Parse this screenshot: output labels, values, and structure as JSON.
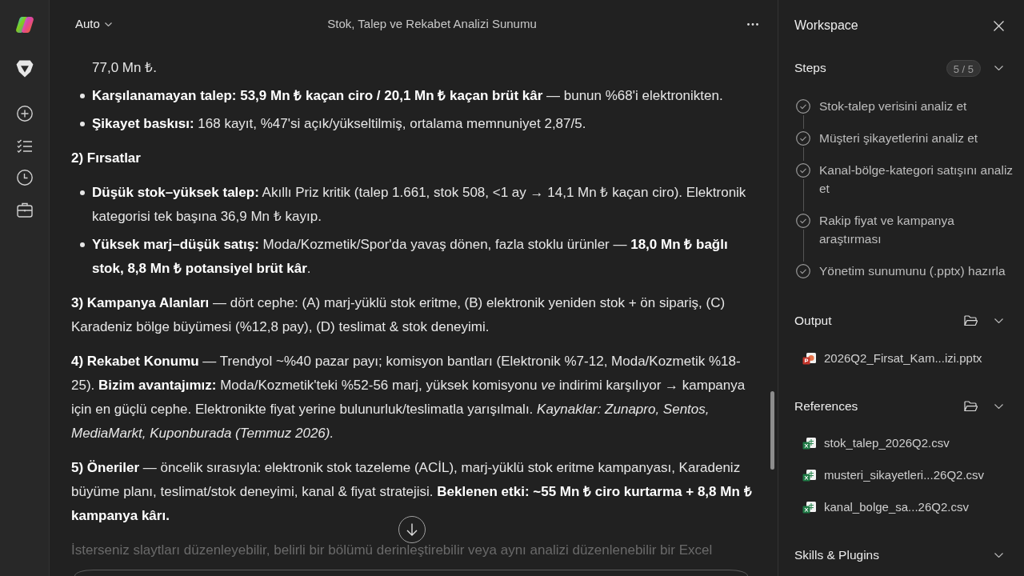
{
  "header": {
    "mode": "Auto",
    "title": "Stok, Talep ve Rekabet Analizi Sunumu"
  },
  "message": {
    "blocks": [
      {
        "kind": "continuation",
        "text": "77,0 Mn ₺."
      },
      {
        "kind": "bullet",
        "text": "**Karşılanamayan talep: 53,9 Mn ₺ kaçan ciro / 20,1 Mn ₺ kaçan brüt kâr** — bunun %68'i elektronikten."
      },
      {
        "kind": "bullet",
        "text": "**Şikayet baskısı:** 168 kayıt, %47'si açık/yükseltilmiş, ortalama memnuniyet 2,87/5."
      },
      {
        "kind": "heading",
        "text": "2) Fırsatlar"
      },
      {
        "kind": "bullet",
        "text": "**Düşük stok–yüksek talep:** Akıllı Priz kritik (talep 1.661, stok 508, <1 ay → 14,1 Mn ₺ kaçan ciro). Elektronik kategorisi tek başına 36,9 Mn ₺ kayıp."
      },
      {
        "kind": "bullet",
        "text": "**Yüksek marj–düşük satış:** Moda/Kozmetik/Spor'da yavaş dönen, fazla stoklu ürünler — **18,0 Mn ₺ bağlı stok, 8,8 Mn ₺ potansiyel brüt kâr**."
      },
      {
        "kind": "paragraph",
        "text": "**3) Kampanya Alanları** — dört cephe: (A) marj-yüklü stok eritme, (B) elektronik yeniden stok + ön sipariş, (C) Karadeniz bölge büyümesi (%12,8 pay), (D) teslimat & stok deneyimi."
      },
      {
        "kind": "paragraph",
        "text": "**4) Rekabet Konumu** — Trendyol ~%40 pazar payı; komisyon bantları (Elektronik %7-12, Moda/Kozmetik %18-25). **Bizim avantajımız:** Moda/Kozmetik'teki %52-56 marj, yüksek komisyonu *ve* indirimi karşılıyor → kampanya için en güçlü cephe. Elektronikte fiyat yerine bulunurluk/teslimatla yarışılmalı. *Kaynaklar: Zunapro, Sentos, MediaMarkt, Kuponburada (Temmuz 2026).*"
      },
      {
        "kind": "paragraph",
        "text": "**5) Öneriler** — öncelik sırasıyla: elektronik stok tazeleme (ACİL), marj-yüklü stok eritme kampanyası, Karadeniz büyüme planı, teslimat/stok deneyimi, kanal & fiyat stratejisi. **Beklenen etki: ~55 Mn ₺ ciro kurtarma + 8,8 Mn ₺ kampanya kârı.**"
      },
      {
        "kind": "faded",
        "text": "İsterseniz slaytları düzenleyebilir, belirli bir bölümü derinleştirebilir veya aynı analizi düzenlenebilir bir Excel"
      }
    ]
  },
  "workspace": {
    "title": "Workspace",
    "steps": {
      "label": "Steps",
      "count": "5 / 5",
      "items": [
        {
          "text": "Stok-talep verisini analiz et",
          "done": true
        },
        {
          "text": "Müşteri şikayetlerini analiz et",
          "done": true
        },
        {
          "text": "Kanal-bölge-kategori satışını analiz et",
          "done": true
        },
        {
          "text": "Rakip fiyat ve kampanya araştırması",
          "done": true
        },
        {
          "text": "Yönetim sunumunu (.pptx) hazırla",
          "done": true
        }
      ]
    },
    "output": {
      "label": "Output",
      "files": [
        {
          "kind": "pptx",
          "name": "2026Q2_Firsat_Kam...izi.pptx"
        }
      ]
    },
    "references": {
      "label": "References",
      "files": [
        {
          "kind": "csv",
          "name": "stok_talep_2026Q2.csv"
        },
        {
          "kind": "csv",
          "name": "musteri_sikayetleri...26Q2.csv"
        },
        {
          "kind": "csv",
          "name": "kanal_bolge_sa...26Q2.csv"
        }
      ]
    },
    "skills": {
      "label": "Skills & Plugins"
    }
  }
}
